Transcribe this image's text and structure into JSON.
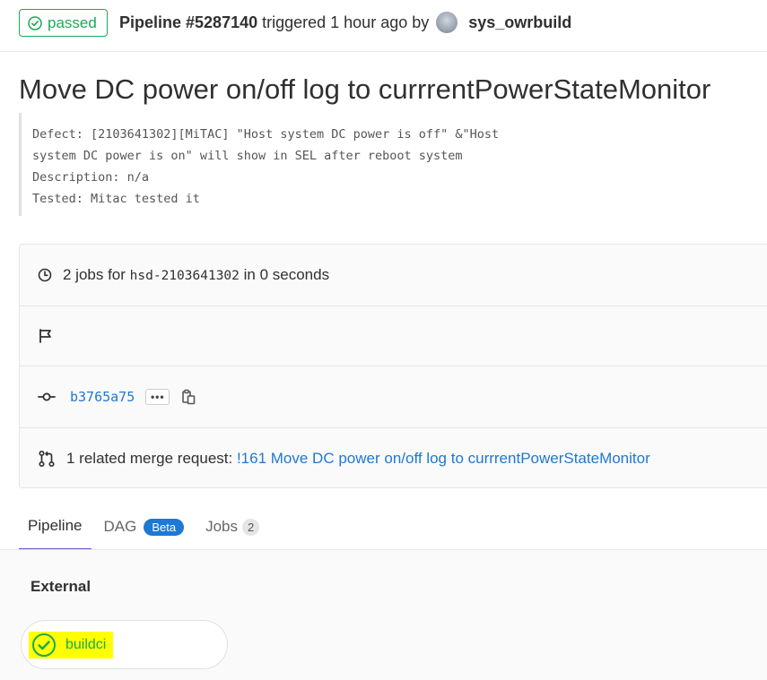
{
  "header": {
    "status_label": "passed",
    "pipeline_label": "Pipeline #5287140",
    "triggered_text": "triggered 1 hour ago by",
    "username": "sys_owrbuild"
  },
  "commit": {
    "title": "Move DC power on/off log to currrentPowerStateMonitor",
    "description_lines": [
      "Defect: [2103641302][MiTAC] \"Host system DC power is off\" &\"Host",
      "system DC power is on\" will show in SEL after reboot system",
      "Description: n/a",
      "Tested: Mitac tested it"
    ]
  },
  "info": {
    "jobs_prefix": "2 jobs for",
    "branch": "hsd-2103641302",
    "jobs_suffix": "in 0 seconds",
    "sha": "b3765a75",
    "ellipsis": "•••",
    "mr_prefix": "1 related merge request:",
    "mr_link": "!161 Move DC power on/off log to currrentPowerStateMonitor"
  },
  "tabs": {
    "pipeline": "Pipeline",
    "dag": "DAG",
    "dag_badge": "Beta",
    "jobs": "Jobs",
    "jobs_count": "2"
  },
  "graph": {
    "stage": "External",
    "job": "buildci"
  },
  "colors": {
    "success": "#1aaa55",
    "link": "#1f78d1",
    "active_tab": "#6b4fbb",
    "highlight": "#ffff00"
  },
  "icons": [
    "check-circle-icon",
    "clock-icon",
    "flag-icon",
    "commit-icon",
    "clipboard-icon",
    "merge-request-icon"
  ]
}
